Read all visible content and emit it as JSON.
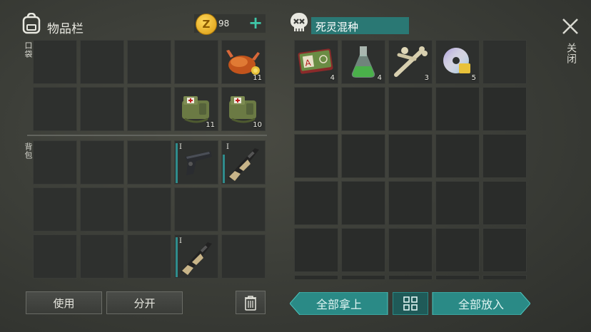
{
  "inventory": {
    "title": "物品栏",
    "coins": "98",
    "pocket_label": "口袋",
    "backpack_label": "背包"
  },
  "container": {
    "title": "死灵混种"
  },
  "close": {
    "label": "关闭"
  },
  "pocket_items": [
    {
      "icon": "roast-chicken-icon",
      "qty": "11"
    },
    {
      "icon": "first-aid-bag-icon",
      "qty": "11"
    },
    {
      "icon": "first-aid-bag-icon",
      "qty": "10"
    }
  ],
  "backpack_items": [
    {
      "icon": "pistol-icon",
      "tier": "I"
    },
    {
      "icon": "assault-rifle-icon",
      "tier": "I"
    },
    {
      "icon": "assault-rifle-icon",
      "tier": "I"
    }
  ],
  "loot_items": [
    {
      "icon": "biohazard-card-icon",
      "qty": "4"
    },
    {
      "icon": "green-flask-icon",
      "qty": "4"
    },
    {
      "icon": "bones-icon",
      "qty": "3"
    },
    {
      "icon": "cd-disc-icon",
      "qty": "5"
    }
  ],
  "buttons": {
    "use": "使用",
    "split": "分开",
    "take_all": "全部拿上",
    "put_all": "全部放入"
  },
  "colors": {
    "accent_teal": "#2a8a86",
    "plus_green": "#3fc7a8",
    "coin_gold": "#e0a820"
  }
}
